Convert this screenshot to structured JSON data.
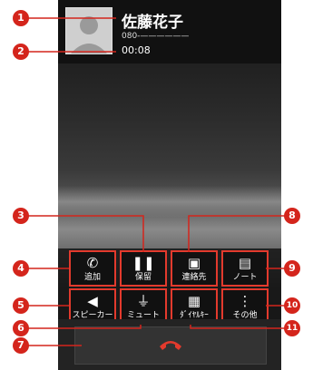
{
  "caller": {
    "name": "佐藤花子",
    "number": "080-——————",
    "duration": "00:08"
  },
  "buttons": {
    "add": "追加",
    "hold": "保留",
    "contacts": "連絡先",
    "note": "ノート",
    "speaker": "スピーカー",
    "mute": "ミュート",
    "dialpad": "ﾀﾞｲﾔﾙｷｰ",
    "other": "その他"
  },
  "callouts": [
    "1",
    "2",
    "3",
    "4",
    "5",
    "6",
    "7",
    "8",
    "9",
    "10",
    "11"
  ],
  "colors": {
    "accent": "#e33a2d",
    "callout": "#d4251c"
  }
}
